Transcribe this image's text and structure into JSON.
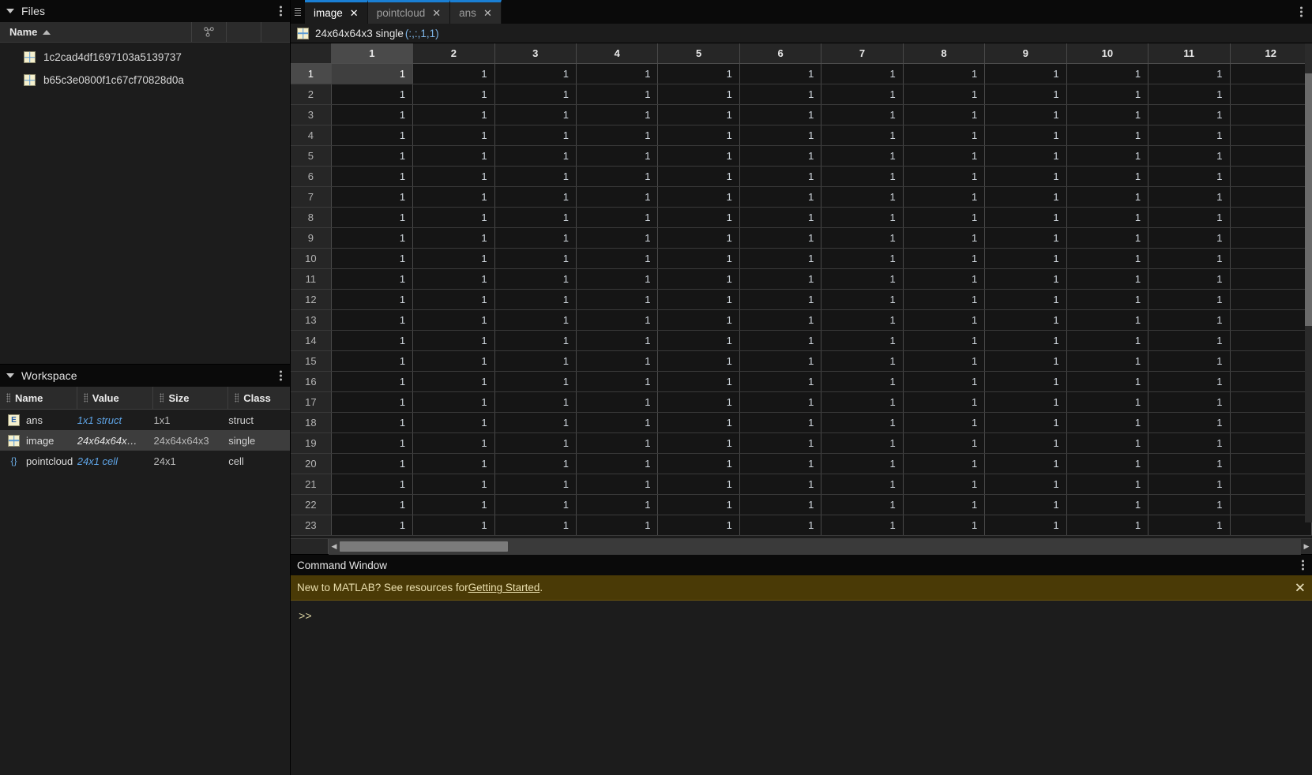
{
  "files_panel": {
    "title": "Files",
    "kebab_icon": "more-vertical-icon",
    "columns": {
      "name": "Name",
      "sort": "sort-ascending-icon",
      "git": "git-branch-icon"
    },
    "items": [
      {
        "name": "1c2cad4df1697103a5139737",
        "icon": "mat-file-icon"
      },
      {
        "name": "b65c3e0800f1c67cf70828d0a",
        "icon": "mat-file-icon"
      }
    ]
  },
  "workspace_panel": {
    "title": "Workspace",
    "kebab_icon": "more-vertical-icon",
    "columns": [
      "Name",
      "Value",
      "Size",
      "Class"
    ],
    "rows": [
      {
        "name": "ans",
        "icon": "struct-icon",
        "value": "1x1 struct",
        "value_style": "link",
        "size": "1x1",
        "class": "struct",
        "selected": false
      },
      {
        "name": "image",
        "icon": "mat-file-icon",
        "value": "24x64x64x…",
        "value_style": "plain",
        "size": "24x64x64x3",
        "class": "single",
        "selected": true
      },
      {
        "name": "pointcloud",
        "icon": "cell-icon",
        "value": "24x1 cell",
        "value_style": "link",
        "size": "24x1",
        "class": "cell",
        "selected": false
      }
    ]
  },
  "editor": {
    "drag_handle_icon": "drag-handle-icon",
    "kebab_icon": "more-vertical-icon",
    "tabs": [
      {
        "label": "image",
        "close_icon": "close-icon",
        "active": true
      },
      {
        "label": "pointcloud",
        "close_icon": "close-icon",
        "active": false
      },
      {
        "label": "ans",
        "close_icon": "close-icon",
        "active": false
      }
    ],
    "variable_header": {
      "icon": "mat-file-icon",
      "text": "24x64x64x3 single ",
      "dims": "(:,:,1,1)"
    }
  },
  "grid": {
    "column_headers": [
      "1",
      "2",
      "3",
      "4",
      "5",
      "6",
      "7",
      "8",
      "9",
      "10",
      "11",
      "12"
    ],
    "row_headers": [
      "1",
      "2",
      "3",
      "4",
      "5",
      "6",
      "7",
      "8",
      "9",
      "10",
      "11",
      "12",
      "13",
      "14",
      "15",
      "16",
      "17",
      "18",
      "19",
      "20",
      "21",
      "22",
      "23"
    ],
    "selected_row": "1",
    "selected_column": "1",
    "cell_value": "1",
    "last_column_empty": true,
    "scroll": {
      "left_arrow_icon": "chevron-left-icon",
      "right_arrow_icon": "chevron-right-icon"
    }
  },
  "command_window": {
    "title": "Command Window",
    "kebab_icon": "more-vertical-icon",
    "banner": {
      "text_before": "New to MATLAB? See resources for ",
      "link": "Getting Started",
      "text_after": ".",
      "close_icon": "close-icon"
    },
    "prompt": ">>"
  },
  "colors": {
    "accent_tab": "#1a7fd4",
    "link": "#56a8f5",
    "banner_bg": "#4a3a06",
    "selection": "#3f3f3f"
  }
}
